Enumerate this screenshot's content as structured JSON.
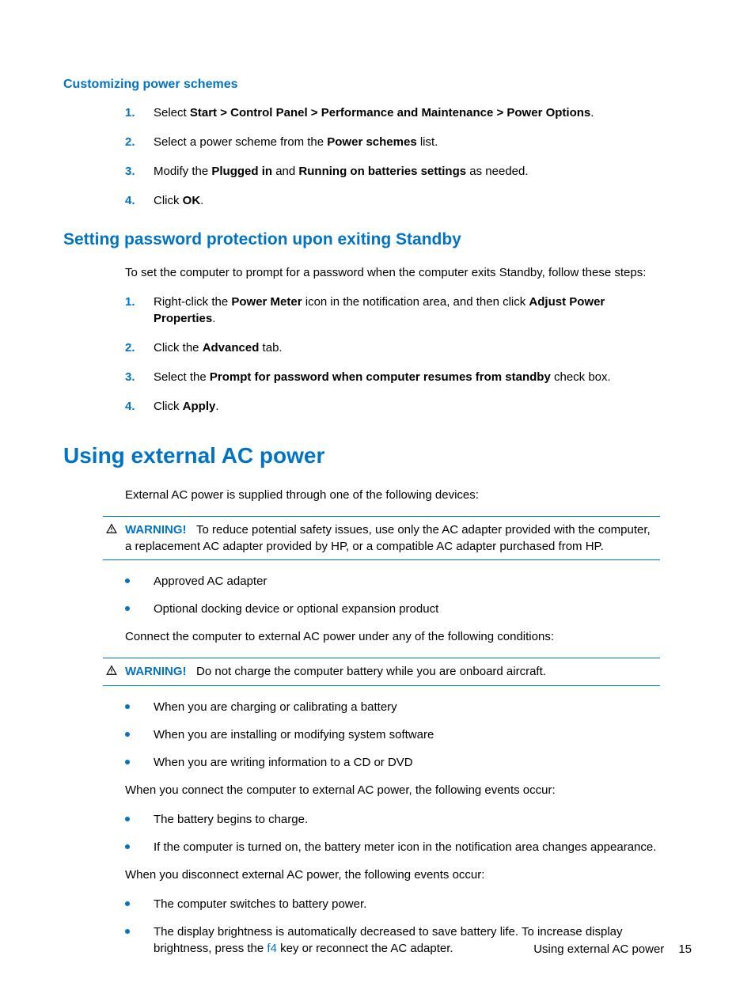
{
  "section1": {
    "heading": "Customizing power schemes",
    "steps": [
      {
        "num": "1.",
        "pre": "Select ",
        "bold": "Start > Control Panel > Performance and Maintenance > Power Options",
        "post": "."
      },
      {
        "num": "2.",
        "pre": "Select a power scheme from the ",
        "bold": "Power schemes",
        "post": " list."
      },
      {
        "num": "3.",
        "pre": "Modify the ",
        "bold": "Plugged in",
        "mid": " and ",
        "bold2": "Running on batteries settings",
        "post": " as needed."
      },
      {
        "num": "4.",
        "pre": "Click ",
        "bold": "OK",
        "post": "."
      }
    ]
  },
  "section2": {
    "heading": "Setting password protection upon exiting Standby",
    "intro": "To set the computer to prompt for a password when the computer exits Standby, follow these steps:",
    "steps": [
      {
        "num": "1.",
        "pre": "Right-click the ",
        "bold": "Power Meter",
        "mid": " icon in the notification area, and then click ",
        "bold2": "Adjust Power Properties",
        "post": "."
      },
      {
        "num": "2.",
        "pre": "Click the ",
        "bold": "Advanced",
        "post": " tab."
      },
      {
        "num": "3.",
        "pre": "Select the ",
        "bold": "Prompt for password when computer resumes from standby",
        "post": " check box."
      },
      {
        "num": "4.",
        "pre": "Click ",
        "bold": "Apply",
        "post": "."
      }
    ]
  },
  "section3": {
    "heading": "Using external AC power",
    "intro": "External AC power is supplied through one of the following devices:",
    "warning1": {
      "label": "WARNING!",
      "text": "To reduce potential safety issues, use only the AC adapter provided with the computer, a replacement AC adapter provided by HP, or a compatible AC adapter purchased from HP."
    },
    "bullets1": [
      "Approved AC adapter",
      "Optional docking device or optional expansion product"
    ],
    "para2": "Connect the computer to external AC power under any of the following conditions:",
    "warning2": {
      "label": "WARNING!",
      "text": "Do not charge the computer battery while you are onboard aircraft."
    },
    "bullets2": [
      "When you are charging or calibrating a battery",
      "When you are installing or modifying system software",
      "When you are writing information to a CD or DVD"
    ],
    "para3": "When you connect the computer to external AC power, the following events occur:",
    "bullets3": [
      "The battery begins to charge.",
      "If the computer is turned on, the battery meter icon in the notification area changes appearance."
    ],
    "para4": "When you disconnect external AC power, the following events occur:",
    "bullets4": [
      {
        "text": "The computer switches to battery power."
      },
      {
        "text_pre": "The display brightness is automatically decreased to save battery life. To increase display brightness, press the ",
        "key": "f4",
        "text_post": " key or reconnect the AC adapter."
      }
    ]
  },
  "footer": {
    "title": "Using external AC power",
    "page": "15"
  }
}
